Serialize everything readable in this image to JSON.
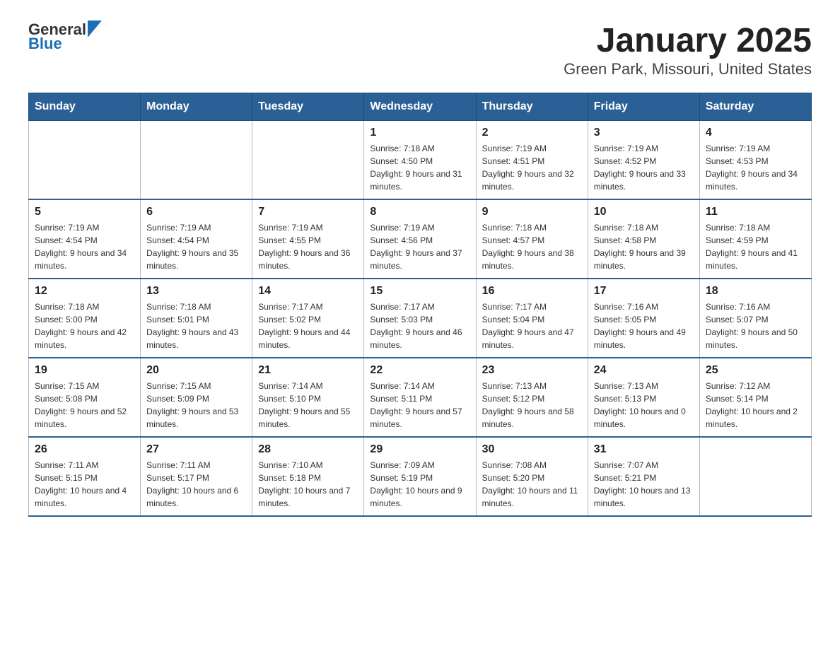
{
  "header": {
    "logo_general": "General",
    "logo_blue": "Blue",
    "title": "January 2025",
    "subtitle": "Green Park, Missouri, United States"
  },
  "days_of_week": [
    "Sunday",
    "Monday",
    "Tuesday",
    "Wednesday",
    "Thursday",
    "Friday",
    "Saturday"
  ],
  "weeks": [
    [
      {
        "day": "",
        "info": ""
      },
      {
        "day": "",
        "info": ""
      },
      {
        "day": "",
        "info": ""
      },
      {
        "day": "1",
        "info": "Sunrise: 7:18 AM\nSunset: 4:50 PM\nDaylight: 9 hours and 31 minutes."
      },
      {
        "day": "2",
        "info": "Sunrise: 7:19 AM\nSunset: 4:51 PM\nDaylight: 9 hours and 32 minutes."
      },
      {
        "day": "3",
        "info": "Sunrise: 7:19 AM\nSunset: 4:52 PM\nDaylight: 9 hours and 33 minutes."
      },
      {
        "day": "4",
        "info": "Sunrise: 7:19 AM\nSunset: 4:53 PM\nDaylight: 9 hours and 34 minutes."
      }
    ],
    [
      {
        "day": "5",
        "info": "Sunrise: 7:19 AM\nSunset: 4:54 PM\nDaylight: 9 hours and 34 minutes."
      },
      {
        "day": "6",
        "info": "Sunrise: 7:19 AM\nSunset: 4:54 PM\nDaylight: 9 hours and 35 minutes."
      },
      {
        "day": "7",
        "info": "Sunrise: 7:19 AM\nSunset: 4:55 PM\nDaylight: 9 hours and 36 minutes."
      },
      {
        "day": "8",
        "info": "Sunrise: 7:19 AM\nSunset: 4:56 PM\nDaylight: 9 hours and 37 minutes."
      },
      {
        "day": "9",
        "info": "Sunrise: 7:18 AM\nSunset: 4:57 PM\nDaylight: 9 hours and 38 minutes."
      },
      {
        "day": "10",
        "info": "Sunrise: 7:18 AM\nSunset: 4:58 PM\nDaylight: 9 hours and 39 minutes."
      },
      {
        "day": "11",
        "info": "Sunrise: 7:18 AM\nSunset: 4:59 PM\nDaylight: 9 hours and 41 minutes."
      }
    ],
    [
      {
        "day": "12",
        "info": "Sunrise: 7:18 AM\nSunset: 5:00 PM\nDaylight: 9 hours and 42 minutes."
      },
      {
        "day": "13",
        "info": "Sunrise: 7:18 AM\nSunset: 5:01 PM\nDaylight: 9 hours and 43 minutes."
      },
      {
        "day": "14",
        "info": "Sunrise: 7:17 AM\nSunset: 5:02 PM\nDaylight: 9 hours and 44 minutes."
      },
      {
        "day": "15",
        "info": "Sunrise: 7:17 AM\nSunset: 5:03 PM\nDaylight: 9 hours and 46 minutes."
      },
      {
        "day": "16",
        "info": "Sunrise: 7:17 AM\nSunset: 5:04 PM\nDaylight: 9 hours and 47 minutes."
      },
      {
        "day": "17",
        "info": "Sunrise: 7:16 AM\nSunset: 5:05 PM\nDaylight: 9 hours and 49 minutes."
      },
      {
        "day": "18",
        "info": "Sunrise: 7:16 AM\nSunset: 5:07 PM\nDaylight: 9 hours and 50 minutes."
      }
    ],
    [
      {
        "day": "19",
        "info": "Sunrise: 7:15 AM\nSunset: 5:08 PM\nDaylight: 9 hours and 52 minutes."
      },
      {
        "day": "20",
        "info": "Sunrise: 7:15 AM\nSunset: 5:09 PM\nDaylight: 9 hours and 53 minutes."
      },
      {
        "day": "21",
        "info": "Sunrise: 7:14 AM\nSunset: 5:10 PM\nDaylight: 9 hours and 55 minutes."
      },
      {
        "day": "22",
        "info": "Sunrise: 7:14 AM\nSunset: 5:11 PM\nDaylight: 9 hours and 57 minutes."
      },
      {
        "day": "23",
        "info": "Sunrise: 7:13 AM\nSunset: 5:12 PM\nDaylight: 9 hours and 58 minutes."
      },
      {
        "day": "24",
        "info": "Sunrise: 7:13 AM\nSunset: 5:13 PM\nDaylight: 10 hours and 0 minutes."
      },
      {
        "day": "25",
        "info": "Sunrise: 7:12 AM\nSunset: 5:14 PM\nDaylight: 10 hours and 2 minutes."
      }
    ],
    [
      {
        "day": "26",
        "info": "Sunrise: 7:11 AM\nSunset: 5:15 PM\nDaylight: 10 hours and 4 minutes."
      },
      {
        "day": "27",
        "info": "Sunrise: 7:11 AM\nSunset: 5:17 PM\nDaylight: 10 hours and 6 minutes."
      },
      {
        "day": "28",
        "info": "Sunrise: 7:10 AM\nSunset: 5:18 PM\nDaylight: 10 hours and 7 minutes."
      },
      {
        "day": "29",
        "info": "Sunrise: 7:09 AM\nSunset: 5:19 PM\nDaylight: 10 hours and 9 minutes."
      },
      {
        "day": "30",
        "info": "Sunrise: 7:08 AM\nSunset: 5:20 PM\nDaylight: 10 hours and 11 minutes."
      },
      {
        "day": "31",
        "info": "Sunrise: 7:07 AM\nSunset: 5:21 PM\nDaylight: 10 hours and 13 minutes."
      },
      {
        "day": "",
        "info": ""
      }
    ]
  ]
}
